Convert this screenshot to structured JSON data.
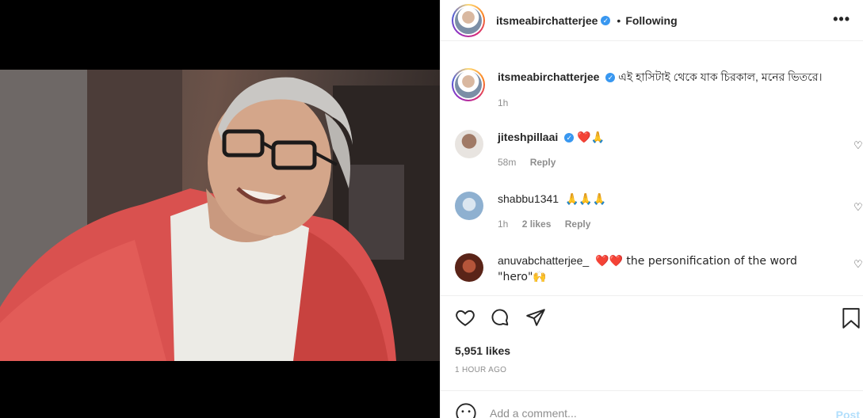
{
  "post": {
    "username": "itsmeabirchatterjee",
    "follow_dot": "•",
    "follow_status": "Following",
    "more_icon": "•••"
  },
  "caption": {
    "username": "itsmeabirchatterjee",
    "text": "এই হাসিটাই থেকে যাক চিরকাল, মনের ভিতরে।",
    "time": "1h"
  },
  "comments": [
    {
      "username": "jiteshpillaai",
      "verified": true,
      "text": "❤️🙏",
      "time": "58m",
      "likes": "",
      "reply": "Reply"
    },
    {
      "username": "shabbu1341",
      "verified": false,
      "text": "🙏🙏🙏",
      "time": "1h",
      "likes": "2 likes",
      "reply": "Reply"
    },
    {
      "username": "anuvabchatterjee_",
      "verified": false,
      "text": "❤️❤️ the personification of the word \"hero\"🙌",
      "time": "",
      "likes": "",
      "reply": ""
    }
  ],
  "actions": {
    "likes": "5,951 likes",
    "timestamp": "1 HOUR AGO"
  },
  "add_comment": {
    "placeholder": "Add a comment...",
    "post_label": "Post"
  },
  "colors": {
    "verified": "#3897f0",
    "heart": "#ed4956",
    "post_disabled": "#b2dffc"
  }
}
